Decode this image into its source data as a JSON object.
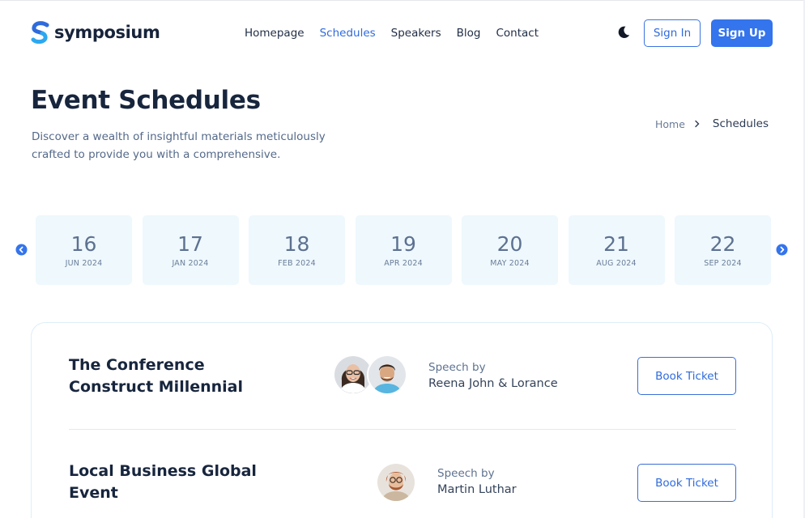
{
  "brand": {
    "name": "symposium"
  },
  "nav": {
    "items": [
      {
        "label": "Homepage",
        "active": false
      },
      {
        "label": "Schedules",
        "active": true
      },
      {
        "label": "Speakers",
        "active": false
      },
      {
        "label": "Blog",
        "active": false
      },
      {
        "label": "Contact",
        "active": false
      }
    ]
  },
  "header": {
    "theme_icon": "moon-icon",
    "sign_in_label": "Sign In",
    "sign_up_label": "Sign Up"
  },
  "hero": {
    "title": "Event Schedules",
    "description": "Discover a wealth of insightful materials meticulously crafted to provide you with a comprehensive."
  },
  "breadcrumb": {
    "home": "Home",
    "current": "Schedules"
  },
  "dates": [
    {
      "day": "16",
      "month": "JUN 2024"
    },
    {
      "day": "17",
      "month": "JAN 2024"
    },
    {
      "day": "18",
      "month": "FEB 2024"
    },
    {
      "day": "19",
      "month": "APR 2024"
    },
    {
      "day": "20",
      "month": "MAY 2024"
    },
    {
      "day": "21",
      "month": "AUG 2024"
    },
    {
      "day": "22",
      "month": "SEP 2024"
    }
  ],
  "events": [
    {
      "title": "The Conference Construct Millennial",
      "speech_label": "Speech by",
      "speakers": "Reena John & Lorance",
      "book_label": "Book Ticket"
    },
    {
      "title": "Local Business Global Event",
      "speech_label": "Speech by",
      "speakers": "Martin Luthar",
      "book_label": "Book Ticket"
    }
  ],
  "colors": {
    "accent": "#3474ec",
    "link": "#2f6bdc",
    "date_card_bg": "#eef8fd",
    "title": "#17253d"
  }
}
